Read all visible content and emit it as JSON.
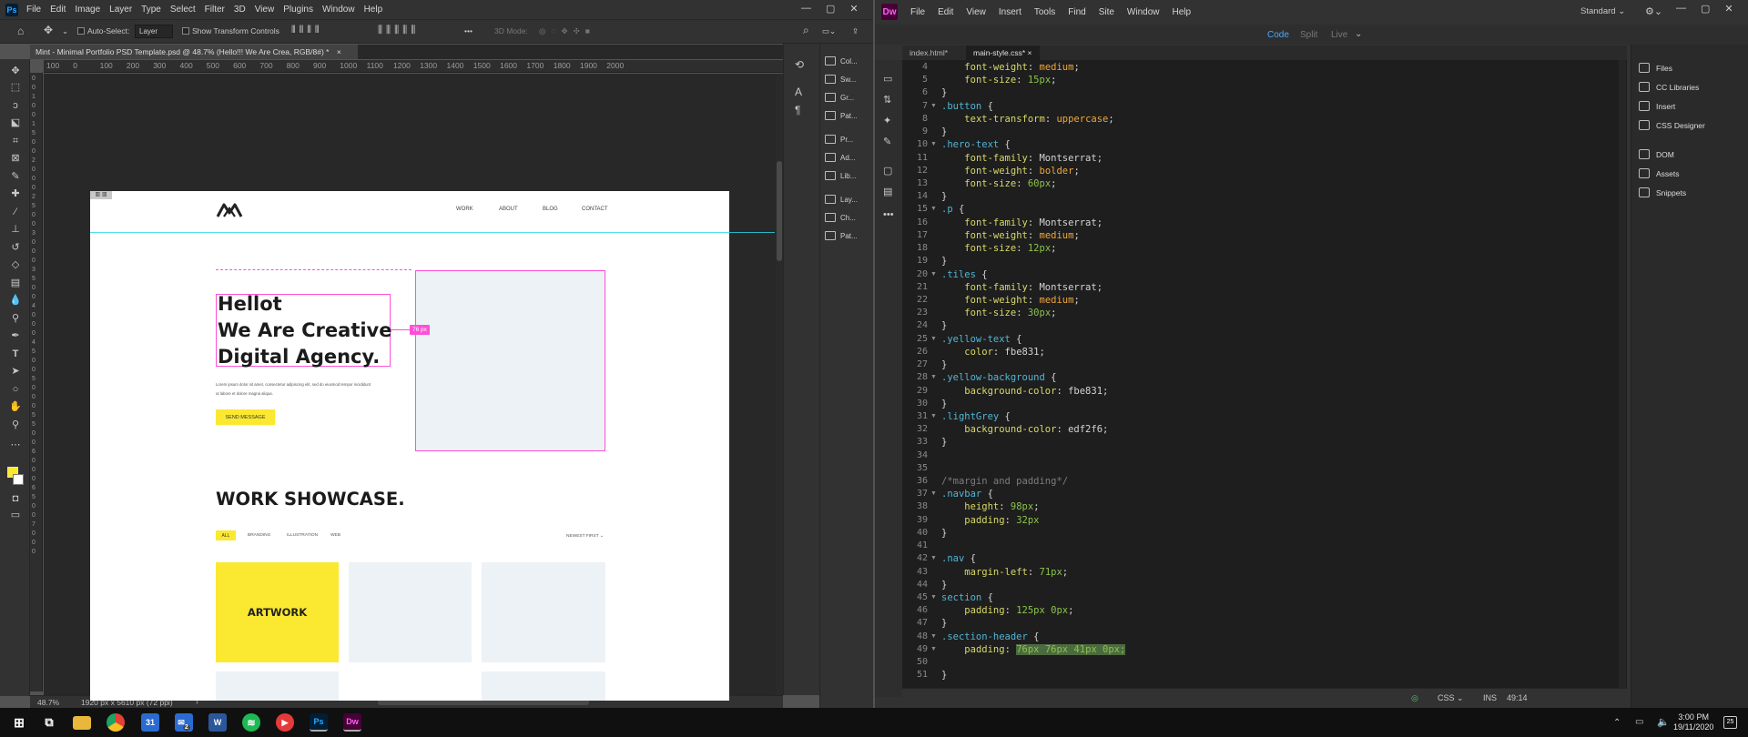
{
  "photoshop": {
    "logo": "Ps",
    "menu": [
      "File",
      "Edit",
      "Image",
      "Layer",
      "Type",
      "Select",
      "Filter",
      "3D",
      "View",
      "Plugins",
      "Window",
      "Help"
    ],
    "window_controls": [
      "—",
      "▢",
      "✕"
    ],
    "options": {
      "auto_select_label": "Auto-Select:",
      "auto_select_value": "Layer",
      "show_transform_label": "Show Transform Controls",
      "three_d_mode": "3D Mode:",
      "more": "•••"
    },
    "tab_title": "Mint - Minimal Portfolio PSD Template.psd @ 48.7% (Hello!!! We Are Crea, RGB/8#) *",
    "tab_close": "×",
    "ruler_top": [
      "100",
      "0",
      "100",
      "200",
      "300",
      "400",
      "500",
      "600",
      "700",
      "800",
      "900",
      "1000",
      "1100",
      "1200",
      "1300",
      "1400",
      "1500",
      "1600",
      "1700",
      "1800",
      "1900",
      "2000"
    ],
    "ruler_left": [
      "0",
      "0",
      "1",
      "0",
      "0",
      "1",
      "5",
      "0",
      "0",
      "2",
      "0",
      "0",
      "0",
      "2",
      "5",
      "0",
      "0",
      "3",
      "0",
      "0",
      "0",
      "3",
      "5",
      "0",
      "0",
      "4",
      "0",
      "0",
      "0",
      "4",
      "5",
      "0",
      "0",
      "5",
      "0",
      "0",
      "0",
      "5",
      "5",
      "0",
      "0",
      "6",
      "0",
      "0",
      "0",
      "6",
      "5",
      "0",
      "0",
      "7",
      "0",
      "0",
      "0"
    ],
    "status": {
      "zoom": "48.7%",
      "doc_size": "1920 px x 5610 px (72 ppi)",
      "arrow": "›"
    },
    "panels": [
      {
        "label": "Col...",
        "icon": "color-icon"
      },
      {
        "label": "Sw...",
        "icon": "swatches-icon"
      },
      {
        "label": "Gr...",
        "icon": "gradients-icon"
      },
      {
        "label": "Pat...",
        "icon": "patterns-icon"
      },
      {
        "label": "Pr...",
        "icon": "properties-icon"
      },
      {
        "label": "Ad...",
        "icon": "adjustments-icon"
      },
      {
        "label": "Lib...",
        "icon": "libraries-icon"
      },
      {
        "label": "Lay...",
        "icon": "layers-icon"
      },
      {
        "label": "Ch...",
        "icon": "channels-icon"
      },
      {
        "label": "Pat...",
        "icon": "paths-icon"
      }
    ],
    "document": {
      "nav": [
        "WORK",
        "ABOUT",
        "BLOG",
        "CONTACT"
      ],
      "hero_lines": [
        "Hellot",
        "We Are Creative",
        "Digital Agency."
      ],
      "lorem": [
        "Lorem ipsum dolor sit amet, consectetur adipiscing elit, sed do eiusmod tempor incididunt",
        "ut labore et dolore magna aliqua."
      ],
      "send_button": "SEND MESSAGE",
      "measure": "76 px",
      "showcase_title": "WORK SHOWCASE.",
      "filters": [
        "ALL",
        "BRANDING",
        "ILLUSTRATION",
        "WEB"
      ],
      "sort": "NEWEST FIRST",
      "tile_label": "ARTWORK",
      "yellow": "#fbe831",
      "grey": "#edf2f6",
      "magenta": "#ff4fd8"
    }
  },
  "dreamweaver": {
    "logo": "Dw",
    "menu": [
      "File",
      "Edit",
      "View",
      "Insert",
      "Tools",
      "Find",
      "Site",
      "Window",
      "Help"
    ],
    "workspace": "Standard",
    "window_controls": [
      "—",
      "▢",
      "✕"
    ],
    "views": [
      "Code",
      "Split",
      "Live"
    ],
    "tabs": [
      "index.html*",
      "main-style.css*"
    ],
    "lines": [
      {
        "n": "4",
        "fold": false,
        "html": "    <span class=\"prop\">font-weight</span>: <span class=\"val-y\">medium</span>;"
      },
      {
        "n": "5",
        "fold": false,
        "html": "    <span class=\"prop\">font-size</span>: <span class=\"val-g\">15px</span>;"
      },
      {
        "n": "6",
        "fold": false,
        "html": "}"
      },
      {
        "n": "7",
        "fold": true,
        "html": "<span class=\"sel\">.button</span> {"
      },
      {
        "n": "8",
        "fold": false,
        "html": "    <span class=\"prop\">text-transform</span>: <span class=\"val-y\">uppercase</span>;"
      },
      {
        "n": "9",
        "fold": false,
        "html": "}"
      },
      {
        "n": "10",
        "fold": true,
        "html": "<span class=\"sel\">.hero-text</span> {"
      },
      {
        "n": "11",
        "fold": false,
        "html": "    <span class=\"prop\">font-family</span>: Montserrat;"
      },
      {
        "n": "12",
        "fold": false,
        "html": "    <span class=\"prop\">font-weight</span>: <span class=\"val-y\">bolder</span>;"
      },
      {
        "n": "13",
        "fold": false,
        "html": "    <span class=\"prop\">font-size</span>: <span class=\"val-g\">60px</span>;"
      },
      {
        "n": "14",
        "fold": false,
        "html": "}"
      },
      {
        "n": "15",
        "fold": true,
        "html": "<span class=\"sel\">.p</span> {"
      },
      {
        "n": "16",
        "fold": false,
        "html": "    <span class=\"prop\">font-family</span>: Montserrat;"
      },
      {
        "n": "17",
        "fold": false,
        "html": "    <span class=\"prop\">font-weight</span>: <span class=\"val-y\">medium</span>;"
      },
      {
        "n": "18",
        "fold": false,
        "html": "    <span class=\"prop\">font-size</span>: <span class=\"val-g\">12px</span>;"
      },
      {
        "n": "19",
        "fold": false,
        "html": "}"
      },
      {
        "n": "20",
        "fold": true,
        "html": "<span class=\"sel\">.tiles</span> {"
      },
      {
        "n": "21",
        "fold": false,
        "html": "    <span class=\"prop\">font-family</span>: Montserrat;"
      },
      {
        "n": "22",
        "fold": false,
        "html": "    <span class=\"prop\">font-weight</span>: <span class=\"val-y\">medium</span>;"
      },
      {
        "n": "23",
        "fold": false,
        "html": "    <span class=\"prop\">font-size</span>: <span class=\"val-g\">30px</span>;"
      },
      {
        "n": "24",
        "fold": false,
        "html": "}"
      },
      {
        "n": "25",
        "fold": true,
        "html": "<span class=\"sel\">.yellow-text</span> {"
      },
      {
        "n": "26",
        "fold": false,
        "html": "    <span class=\"prop\">color</span>: fbe831;"
      },
      {
        "n": "27",
        "fold": false,
        "html": "}"
      },
      {
        "n": "28",
        "fold": true,
        "html": "<span class=\"sel\">.yellow-background</span> {"
      },
      {
        "n": "29",
        "fold": false,
        "html": "    <span class=\"prop\">background-color</span>: fbe831;"
      },
      {
        "n": "30",
        "fold": false,
        "html": "}"
      },
      {
        "n": "31",
        "fold": true,
        "html": "<span class=\"sel\">.lightGrey</span> {"
      },
      {
        "n": "32",
        "fold": false,
        "html": "    <span class=\"prop\">background-color</span>: edf2f6;"
      },
      {
        "n": "33",
        "fold": false,
        "html": "}"
      },
      {
        "n": "34",
        "fold": false,
        "html": ""
      },
      {
        "n": "35",
        "fold": false,
        "html": ""
      },
      {
        "n": "36",
        "fold": false,
        "html": "<span class=\"cm\">/*margin and padding*/</span>"
      },
      {
        "n": "37",
        "fold": true,
        "html": "<span class=\"sel\">.navbar</span> {"
      },
      {
        "n": "38",
        "fold": false,
        "html": "    <span class=\"prop\">height</span>: <span class=\"val-g\">98px</span>;"
      },
      {
        "n": "39",
        "fold": false,
        "html": "    <span class=\"prop\">padding</span>: <span class=\"val-g\">32px</span>"
      },
      {
        "n": "40",
        "fold": false,
        "html": "}"
      },
      {
        "n": "41",
        "fold": false,
        "html": ""
      },
      {
        "n": "42",
        "fold": true,
        "html": "<span class=\"sel\">.nav</span> {"
      },
      {
        "n": "43",
        "fold": false,
        "html": "    <span class=\"prop\">margin-left</span>: <span class=\"val-g\">71px</span>;"
      },
      {
        "n": "44",
        "fold": false,
        "html": "}"
      },
      {
        "n": "45",
        "fold": true,
        "html": "<span class=\"sel\">section</span> {"
      },
      {
        "n": "46",
        "fold": false,
        "html": "    <span class=\"prop\">padding</span>: <span class=\"val-g\">125px 0px</span>;"
      },
      {
        "n": "47",
        "fold": false,
        "html": "}"
      },
      {
        "n": "48",
        "fold": true,
        "html": "<span class=\"sel\">.section-header</span> {"
      },
      {
        "n": "49",
        "fold": true,
        "html": "    <span class=\"prop\">padding</span>: <span class=\"val-g hl\">76px 76px 41px 0px;</span>"
      },
      {
        "n": "50",
        "fold": false,
        "html": ""
      },
      {
        "n": "51",
        "fold": false,
        "html": "}"
      }
    ],
    "right_panels": [
      {
        "label": "Files",
        "icon": "files-icon"
      },
      {
        "label": "CC Libraries",
        "icon": "cc-libraries-icon"
      },
      {
        "label": "Insert",
        "icon": "insert-icon"
      },
      {
        "label": "CSS Designer",
        "icon": "css-designer-icon"
      },
      {
        "label": "DOM",
        "icon": "dom-icon"
      },
      {
        "label": "Assets",
        "icon": "assets-icon"
      },
      {
        "label": "Snippets",
        "icon": "snippets-icon"
      }
    ],
    "status": {
      "lang": "CSS",
      "mode": "INS",
      "position": "49:14"
    }
  },
  "taskbar": {
    "time": "3:00 PM",
    "date": "19/11/2020",
    "notifications": "25",
    "apps": [
      {
        "name": "file-explorer",
        "label": ""
      },
      {
        "name": "chrome",
        "label": ""
      },
      {
        "name": "calendar",
        "label": "31"
      },
      {
        "name": "mail",
        "label": "2"
      },
      {
        "name": "word",
        "label": "W"
      },
      {
        "name": "spotify",
        "label": ""
      },
      {
        "name": "media-player",
        "label": "▶"
      },
      {
        "name": "photoshop",
        "label": "Ps"
      },
      {
        "name": "dreamweaver",
        "label": "Dw"
      }
    ]
  }
}
